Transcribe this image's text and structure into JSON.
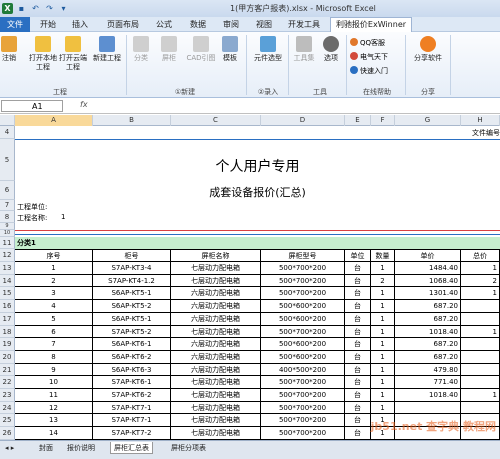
{
  "window": {
    "title": "1(甲方客户报表).xlsx - Microsoft Excel"
  },
  "tabs": [
    "文件",
    "开始",
    "插入",
    "页面布局",
    "公式",
    "数据",
    "审阅",
    "视图",
    "开发工具",
    "利驰报价ExWinner"
  ],
  "ribbon": {
    "buttons": {
      "logout": "注销",
      "open_project": "打开本地工程",
      "open_cloud": "打开云端工程",
      "new_project": "新建工程",
      "category": "分类",
      "cabinet": "屏柜",
      "cad": "CAD引图",
      "template": "模板",
      "component_select": "元件选型",
      "toolbox": "工具集",
      "options": "选项",
      "qq": "QQ客服",
      "dianqi": "电气天下",
      "quickstart": "快速入门",
      "share_software": "分享软件"
    },
    "groups": {
      "project": "工程",
      "new": "①新建",
      "entry": "②录入",
      "tools": "工具",
      "online_help": "在线帮助",
      "share": "分享"
    }
  },
  "formula_bar": {
    "name_box": "A1",
    "fx": "fx",
    "value": ""
  },
  "columns": [
    "A",
    "B",
    "C",
    "D",
    "E",
    "F",
    "G",
    "H"
  ],
  "sheet": {
    "doc_no_label": "文件编号",
    "title": "个人用户专用",
    "subtitle": "成套设备报价(汇总)",
    "project_unit_label": "工程单位:",
    "project_name_label": "工程名称:",
    "project_name_value": "1",
    "category": "分类1",
    "headers": [
      "序号",
      "柜号",
      "屏柜名称",
      "屏柜型号",
      "单位",
      "数量",
      "单价",
      "总价"
    ],
    "rows": [
      {
        "row": "13",
        "n": "1",
        "code": "S7AP-KT3-4",
        "name": "七层动力配电箱",
        "model": "500*700*200",
        "unit": "台",
        "qty": "1",
        "price": "1484.40",
        "total": "1"
      },
      {
        "row": "14",
        "n": "2",
        "code": "S7AP-KT4-1.2",
        "name": "七层动力配电箱",
        "model": "500*700*200",
        "unit": "台",
        "qty": "2",
        "price": "1068.40",
        "total": "2"
      },
      {
        "row": "15",
        "n": "3",
        "code": "S6AP-KT5-1",
        "name": "六层动力配电箱",
        "model": "500*700*200",
        "unit": "台",
        "qty": "1",
        "price": "1301.40",
        "total": "1"
      },
      {
        "row": "16",
        "n": "4",
        "code": "S6AP-KT5-2",
        "name": "六层动力配电箱",
        "model": "500*600*200",
        "unit": "台",
        "qty": "1",
        "price": "687.20",
        "total": ""
      },
      {
        "row": "17",
        "n": "5",
        "code": "S6AP-KT5-1",
        "name": "六层动力配电箱",
        "model": "500*600*200",
        "unit": "台",
        "qty": "1",
        "price": "687.20",
        "total": ""
      },
      {
        "row": "18",
        "n": "6",
        "code": "S7AP-KT5-2",
        "name": "七层动力配电箱",
        "model": "500*700*200",
        "unit": "台",
        "qty": "1",
        "price": "1018.40",
        "total": "1"
      },
      {
        "row": "19",
        "n": "7",
        "code": "S6AP-KT6-1",
        "name": "六层动力配电箱",
        "model": "500*600*200",
        "unit": "台",
        "qty": "1",
        "price": "687.20",
        "total": ""
      },
      {
        "row": "20",
        "n": "8",
        "code": "S6AP-KT6-2",
        "name": "六层动力配电箱",
        "model": "500*600*200",
        "unit": "台",
        "qty": "1",
        "price": "687.20",
        "total": ""
      },
      {
        "row": "21",
        "n": "9",
        "code": "S6AP-KT6-3",
        "name": "六层动力配电箱",
        "model": "400*500*200",
        "unit": "台",
        "qty": "1",
        "price": "479.80",
        "total": ""
      },
      {
        "row": "22",
        "n": "10",
        "code": "S7AP-KT6-1",
        "name": "七层动力配电箱",
        "model": "500*700*200",
        "unit": "台",
        "qty": "1",
        "price": "771.40",
        "total": ""
      },
      {
        "row": "23",
        "n": "11",
        "code": "S7AP-KT6-2",
        "name": "七层动力配电箱",
        "model": "500*700*200",
        "unit": "台",
        "qty": "1",
        "price": "1018.40",
        "total": "1"
      },
      {
        "row": "24",
        "n": "12",
        "code": "S7AP-KT7-1",
        "name": "七层动力配电箱",
        "model": "500*700*200",
        "unit": "台",
        "qty": "1",
        "price": "",
        "total": ""
      },
      {
        "row": "25",
        "n": "13",
        "code": "S7AP-KT7-1",
        "name": "七层动力配电箱",
        "model": "500*700*200",
        "unit": "台",
        "qty": "1",
        "price": "",
        "total": ""
      },
      {
        "row": "26",
        "n": "14",
        "code": "S7AP-KT7-2",
        "name": "七层动力配电箱",
        "model": "500*700*200",
        "unit": "台",
        "qty": "1",
        "price": "",
        "total": ""
      }
    ]
  },
  "sheet_tabs": [
    "封面",
    "报价说明",
    "屏柜汇总表",
    "屏柜分项表"
  ],
  "watermark": "jb51.net 查字典 教程网",
  "colors": {
    "accent": "#2a6fc2",
    "category_fill": "#c6efce",
    "selected_header": "#f9d99a",
    "active_tab_blue": "#1d5a9e"
  }
}
